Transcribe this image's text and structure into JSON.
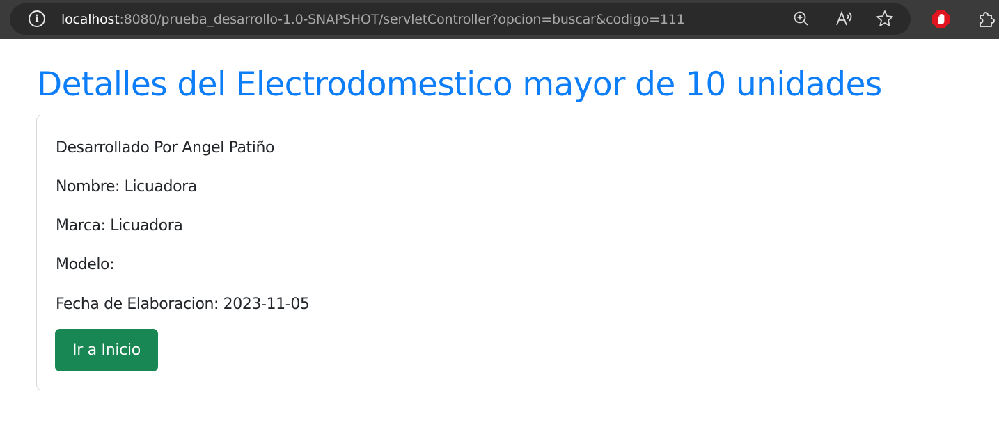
{
  "browser": {
    "url_host": "localhost",
    "url_rest": ":8080/prueba_desarrollo-1.0-SNAPSHOT/servletController?opcion=buscar&codigo=111",
    "info_icon": "info-icon",
    "toolbar_icons": [
      "zoom-in-icon",
      "read-aloud-icon",
      "favorite-star-icon"
    ],
    "extension_icons": [
      "stop-hand-extension-icon",
      "extensions-puzzle-icon"
    ]
  },
  "page": {
    "title": "Detalles del Electrodomestico mayor de 10 unidades",
    "developed_by": "Desarrollado Por Angel Patiño",
    "nombre": "Nombre: Licuadora",
    "marca": "Marca: Licuadora",
    "modelo": "Modelo:",
    "fecha": "Fecha de Elaboracion: 2023-11-05",
    "home_button": "Ir a Inicio"
  },
  "colors": {
    "title": "#0d7ef8",
    "button": "#198754",
    "browser_bar": "#3b3b3b",
    "stop_extension": "#e0141e"
  }
}
